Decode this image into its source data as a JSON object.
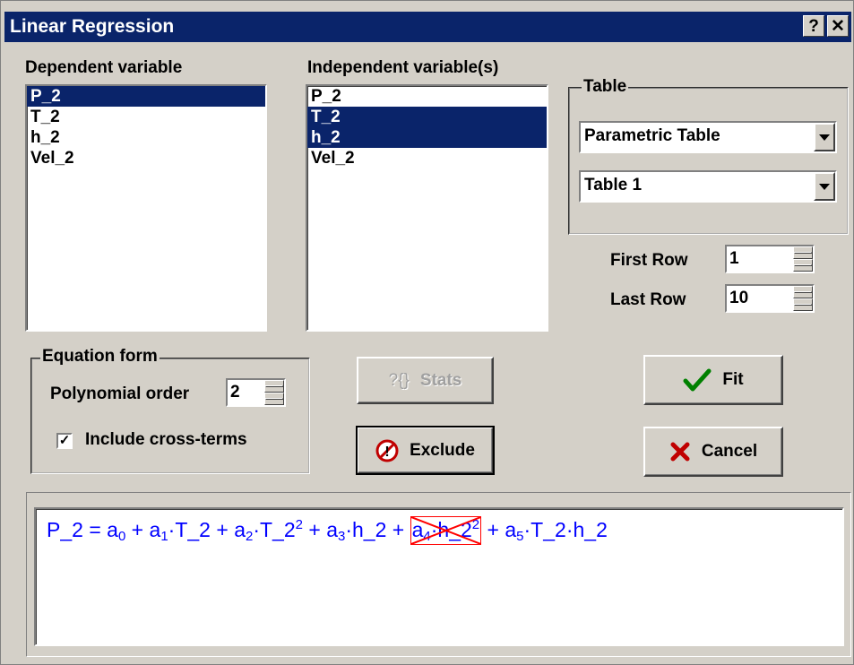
{
  "window": {
    "title": "Linear Regression",
    "help_label": "?",
    "close_label": "✕"
  },
  "dependent": {
    "label": "Dependent variable",
    "items": [
      "P_2",
      "T_2",
      "h_2",
      "Vel_2"
    ],
    "selected": [
      "P_2"
    ]
  },
  "independent": {
    "label": "Independent variable(s)",
    "items": [
      "P_2",
      "T_2",
      "h_2",
      "Vel_2"
    ],
    "selected": [
      "T_2",
      "h_2"
    ]
  },
  "table_group": {
    "label": "Table",
    "table_type": "Parametric Table",
    "table_name": "Table 1"
  },
  "rows": {
    "first_label": "First Row",
    "first_value": "1",
    "last_label": "Last Row",
    "last_value": "10"
  },
  "equation_form": {
    "label": "Equation form",
    "poly_label": "Polynomial order",
    "poly_value": "2",
    "cross_label": "Include cross-terms",
    "cross_checked": true
  },
  "buttons": {
    "stats": "Stats",
    "stats_icon_text": "?{}",
    "exclude": "Exclude",
    "fit": "Fit",
    "cancel": "Cancel"
  },
  "equation": {
    "lhs": "P_2",
    "eq": " = ",
    "a": "a",
    "plus": " + ",
    "dot": "·",
    "T": "T_2",
    "h": "h_2",
    "sq": "2",
    "s0": "0",
    "s1": "1",
    "s2": "2",
    "s3": "3",
    "s4": "4",
    "s5": "5"
  },
  "colors": {
    "titlebar": "#0a246a",
    "selection": "#0a246a",
    "equation_text": "#0000ff",
    "excluded_mark": "#ff0000",
    "fit_check": "#008000",
    "cancel_x": "#c00000"
  }
}
